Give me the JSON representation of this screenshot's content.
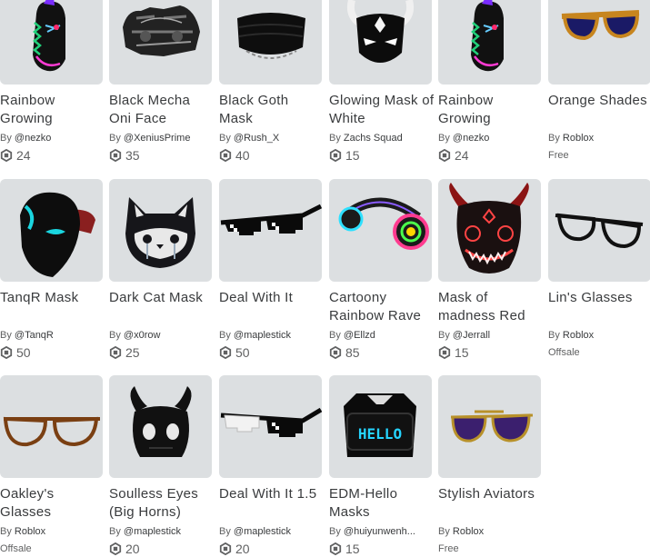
{
  "items": [
    {
      "name": "Rainbow Growing",
      "by": "By",
      "creator": "@nezko",
      "price": "24",
      "icon": "rainbow-growing-mask-icon"
    },
    {
      "name": "Black Mecha Oni Face",
      "by": "By",
      "creator": "@XeniusPrime",
      "price": "35",
      "icon": "mecha-oni-face-icon"
    },
    {
      "name": "Black Goth Mask",
      "by": "By",
      "creator": "@Rush_X",
      "price": "40",
      "icon": "goth-mask-icon"
    },
    {
      "name": "Glowing Mask of White",
      "by": "By",
      "creator": "Zachs Squad",
      "price": "15",
      "icon": "glowing-mask-icon"
    },
    {
      "name": "Rainbow Growing",
      "by": "By",
      "creator": "@nezko",
      "price": "24",
      "icon": "rainbow-growing-mask-icon"
    },
    {
      "name": "Orange Shades",
      "by": "By",
      "creator": "Roblox",
      "price": "Free",
      "icon": "orange-shades-icon"
    },
    {
      "name": "TanqR Mask",
      "by": "By",
      "creator": "@TanqR",
      "price": "50",
      "icon": "tanqr-mask-icon"
    },
    {
      "name": "Dark Cat Mask",
      "by": "By",
      "creator": "@x0row",
      "price": "25",
      "icon": "dark-cat-mask-icon"
    },
    {
      "name": "Deal With It",
      "by": "By",
      "creator": "@maplestick",
      "price": "50",
      "icon": "pixel-sunglasses-icon"
    },
    {
      "name": "Cartoony Rainbow Rave",
      "by": "By",
      "creator": "@Ellzd",
      "price": "85",
      "icon": "rave-headphones-icon"
    },
    {
      "name": "Mask of madness Red",
      "by": "By",
      "creator": "@Jerrall",
      "price": "15",
      "icon": "madness-mask-icon"
    },
    {
      "name": "Lin's Glasses",
      "by": "By",
      "creator": "Roblox",
      "price": "Offsale",
      "icon": "black-glasses-icon"
    },
    {
      "name": "Oakley's Glasses",
      "by": "By",
      "creator": "Roblox",
      "price": "Offsale",
      "icon": "brown-glasses-icon"
    },
    {
      "name": "Soulless Eyes (Big Horns)",
      "by": "By",
      "creator": "@maplestick",
      "price": "20",
      "icon": "horned-mask-icon"
    },
    {
      "name": "Deal With It 1.5",
      "by": "By",
      "creator": "@maplestick",
      "price": "20",
      "icon": "white-pixel-sunglasses-icon"
    },
    {
      "name": "EDM-Hello Masks",
      "by": "By",
      "creator": "@huiyunwenh...",
      "price": "15",
      "icon": "led-hello-mask-icon",
      "led_text": "HELLO"
    },
    {
      "name": "Stylish Aviators",
      "by": "By",
      "creator": "Roblox",
      "price": "Free",
      "icon": "aviator-sunglasses-icon"
    }
  ],
  "colors": {
    "thumb_bg": "#dcdfe1",
    "text": "#393b3d",
    "muted": "#606162"
  }
}
